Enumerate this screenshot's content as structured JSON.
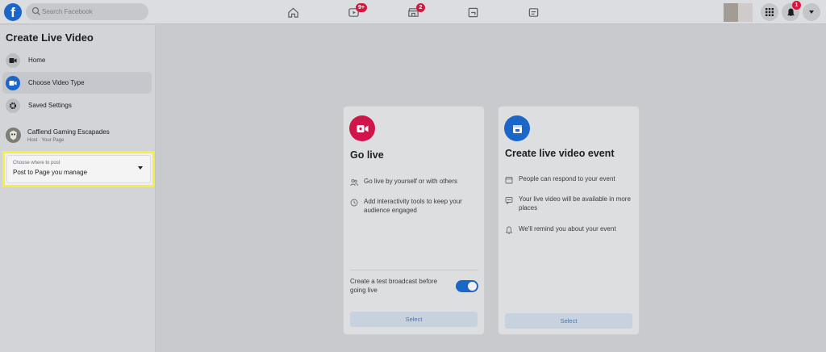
{
  "topbar": {
    "logo": "f",
    "search_placeholder": "Search Facebook",
    "nav": [
      {
        "name": "home",
        "badge": ""
      },
      {
        "name": "watch",
        "badge": "9+"
      },
      {
        "name": "marketplace",
        "badge": "2"
      },
      {
        "name": "groups",
        "badge": ""
      },
      {
        "name": "gaming",
        "badge": ""
      }
    ],
    "notifications_badge": "1"
  },
  "sidebar": {
    "title": "Create Live Video",
    "items": [
      {
        "label": "Home",
        "icon": "video-camera-icon"
      },
      {
        "label": "Choose Video Type",
        "icon": "video-camera-icon",
        "active": true
      },
      {
        "label": "Saved Settings",
        "icon": "gear-icon"
      }
    ],
    "page": {
      "name": "Caffiend Gaming Escapades",
      "role": "Host · Your Page"
    },
    "post_select": {
      "label": "Choose where to post",
      "value": "Post to Page you manage"
    }
  },
  "cards": {
    "go_live": {
      "title": "Go live",
      "features": [
        "Go live by yourself or with others",
        "Add interactivity tools to keep your audience engaged"
      ],
      "toggle_text": "Create a test broadcast before going live",
      "toggle_on": true,
      "button": "Select",
      "icon_color": "#d0154a"
    },
    "event": {
      "title": "Create live video event",
      "features": [
        "People can respond to your event",
        "Your live video will be available in more places",
        "We'll remind you about your event"
      ],
      "button": "Select",
      "icon_color": "#1b66c9"
    }
  }
}
